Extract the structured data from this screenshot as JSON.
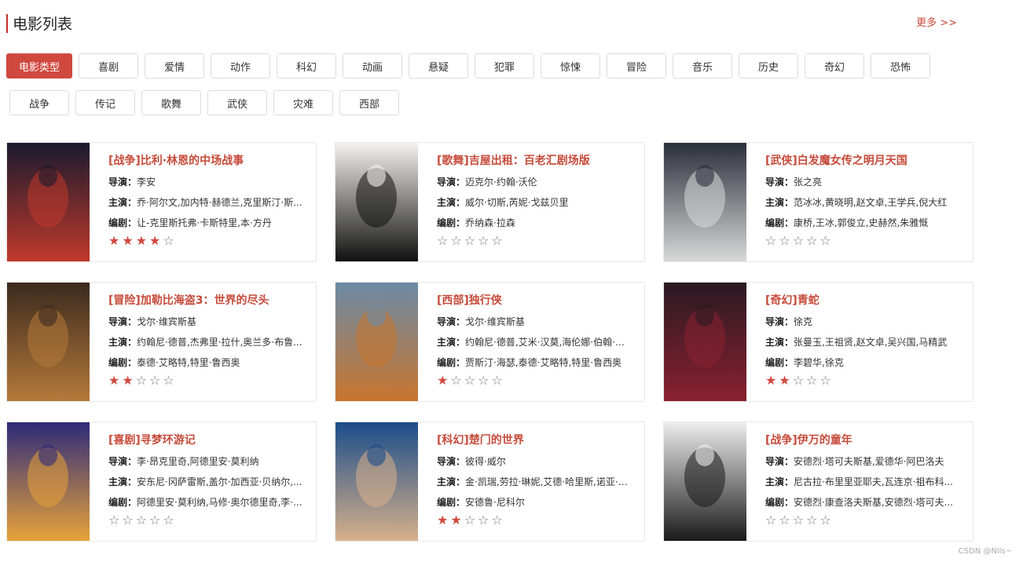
{
  "header": {
    "title": "电影列表",
    "more": "更多 >>"
  },
  "genres": {
    "row1": [
      "电影类型",
      "喜剧",
      "爱情",
      "动作",
      "科幻",
      "动画",
      "悬疑",
      "犯罪",
      "惊悚",
      "冒险",
      "音乐",
      "历史",
      "奇幻",
      "恐怖"
    ],
    "row2": [
      "战争",
      "传记",
      "歌舞",
      "武侠",
      "灾难",
      "西部"
    ]
  },
  "labels": {
    "director": "导演：",
    "cast": "主演：",
    "writer": "编剧："
  },
  "movies": [
    {
      "title": "[战争]比利·林恩的中场战事",
      "director": "李安",
      "cast": "乔·阿尔文,加内特·赫德兰,克里斯汀·斯...",
      "writer": "让-克里斯托弗·卡斯特里,本·方丹",
      "rating": 4,
      "poster_colors": [
        "#1a1a2e",
        "#c0392b"
      ]
    },
    {
      "title": "[歌舞]吉屋出租：百老汇剧场版",
      "director": "迈克尔·约翰·沃伦",
      "cast": "威尔·切斯,芮妮·戈兹贝里",
      "writer": "乔纳森·拉森",
      "rating": 0,
      "poster_colors": [
        "#f4f2ee",
        "#111111"
      ]
    },
    {
      "title": "[武侠]白发魔女传之明月天国",
      "director": "张之亮",
      "cast": "范冰冰,黄晓明,赵文卓,王学兵,倪大红",
      "writer": "康桥,王冰,郭俊立,史赫然,朱雅慨",
      "rating": 0,
      "poster_colors": [
        "#2b2f3a",
        "#d9d9d9"
      ]
    },
    {
      "title": "[冒险]加勒比海盗3：世界的尽头",
      "director": "戈尔·维宾斯基",
      "cast": "约翰尼·德普,杰弗里·拉什,奥兰多·布鲁...",
      "writer": "泰德·艾略特,特里·鲁西奥",
      "rating": 2,
      "poster_colors": [
        "#3b2a1e",
        "#b5793a"
      ]
    },
    {
      "title": "[西部]独行侠",
      "director": "戈尔·维宾斯基",
      "cast": "约翰尼·德普,艾米·汉莫,海伦娜·伯翰·卡...",
      "writer": "贾斯汀·海瑟,泰德·艾略特,特里·鲁西奥",
      "rating": 1,
      "poster_colors": [
        "#6b8aa6",
        "#c9762e"
      ]
    },
    {
      "title": "[奇幻]青蛇",
      "director": "徐克",
      "cast": "张曼玉,王祖贤,赵文卓,吴兴国,马精武",
      "writer": "李碧华,徐克",
      "rating": 2,
      "poster_colors": [
        "#2a1a22",
        "#8a2030"
      ]
    },
    {
      "title": "[喜剧]寻梦环游记",
      "director": "李·昂克里奇,阿德里安·莫利纳",
      "cast": "安东尼·冈萨雷斯,盖尔·加西亚·贝纳尔,...",
      "writer": "阿德里安·莫利纳,马修·奥尔德里奇,李·...",
      "rating": 0,
      "poster_colors": [
        "#2d2a7a",
        "#e8a33a"
      ]
    },
    {
      "title": "[科幻]楚门的世界",
      "director": "彼得·威尔",
      "cast": "金·凯瑞,劳拉·琳妮,艾德·哈里斯,诺亚·艾...",
      "writer": "安德鲁·尼科尔",
      "rating": 2,
      "poster_colors": [
        "#1b4d8a",
        "#d8b08a"
      ]
    },
    {
      "title": "[战争]伊万的童年",
      "director": "安德烈·塔可夫斯基,爱德华·阿巴洛夫",
      "cast": "尼古拉·布里里亚耶夫,瓦连京·祖布科...",
      "writer": "安德烈·康查洛夫斯基,安德烈·塔可夫...",
      "rating": 0,
      "poster_colors": [
        "#ededed",
        "#1a1a1a"
      ]
    }
  ],
  "watermark": "CSDN @Nils~"
}
